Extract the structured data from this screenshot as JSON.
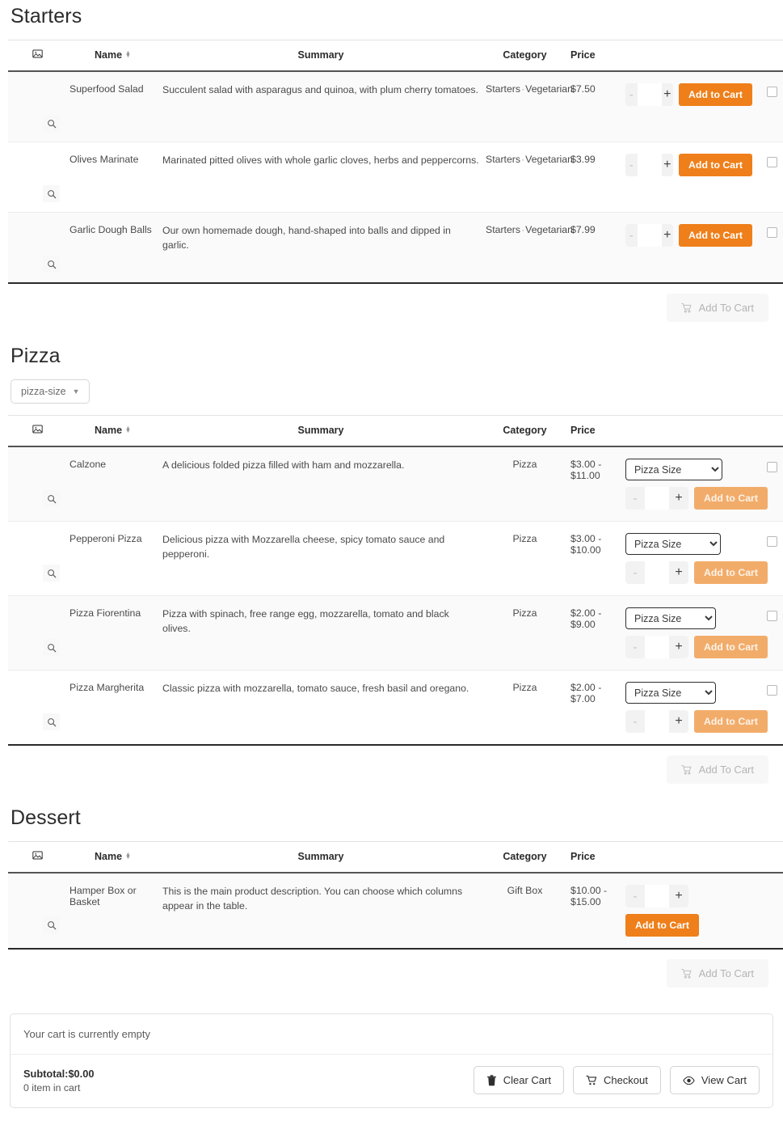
{
  "colors": {
    "accent": "#ef7f1a",
    "accent_disabled": "#f2ac6a",
    "text": "#3a3a3a"
  },
  "columns": {
    "image": "image-icon",
    "name": "Name",
    "summary": "Summary",
    "category": "Category",
    "price": "Price"
  },
  "sections": [
    {
      "id": "starters",
      "title": "Starters",
      "filter": null,
      "bulk_add_label": "Add To Cart",
      "rows": [
        {
          "name": "Superfood Salad",
          "summary": "Succulent salad with asparagus and quinoa, with plum cherry tomatoes.",
          "category": "Starters",
          "category2": "Vegetarian",
          "price": "$7.50",
          "qty": "",
          "minus_label": "-",
          "plus_label": "+",
          "add_label": "Add to Cart",
          "add_disabled": false,
          "has_select": false,
          "has_checkbox": true,
          "thumb": "salad"
        },
        {
          "name": "Olives Marinate",
          "summary": "Marinated pitted olives with whole garlic cloves, herbs and peppercorns.",
          "category": "Starters",
          "category2": "Vegetarian",
          "price": "$3.99",
          "qty": "",
          "minus_label": "-",
          "plus_label": "+",
          "add_label": "Add to Cart",
          "add_disabled": false,
          "has_select": false,
          "has_checkbox": true,
          "thumb": "olives"
        },
        {
          "name": "Garlic Dough Balls",
          "summary": "Our own homemade dough, hand-shaped into balls and dipped in garlic.",
          "category": "Starters",
          "category2": "Vegetarian",
          "price": "$7.99",
          "qty": "",
          "minus_label": "-",
          "plus_label": "+",
          "add_label": "Add to Cart",
          "add_disabled": false,
          "has_select": false,
          "has_checkbox": true,
          "thumb": "dough"
        }
      ]
    },
    {
      "id": "pizza",
      "title": "Pizza",
      "filter": {
        "label": "pizza-size",
        "icon": "chevron-down-icon"
      },
      "bulk_add_label": "Add To Cart",
      "rows": [
        {
          "name": "Calzone",
          "summary": "A delicious folded pizza filled with ham and mozzarella.",
          "category": "Pizza",
          "category2": null,
          "price": "$3.00 - $11.00",
          "qty": "",
          "minus_label": "-",
          "plus_label": "+",
          "add_label": "Add to Cart",
          "add_disabled": true,
          "has_select": true,
          "select_value": "Pizza Size",
          "select_width": 120,
          "has_checkbox": true,
          "thumb": "calzone"
        },
        {
          "name": "Pepperoni Pizza",
          "summary": "Delicious pizza with Mozzarella cheese, spicy tomato sauce and pepperoni.",
          "category": "Pizza",
          "category2": null,
          "price": "$3.00 - $10.00",
          "qty": "",
          "minus_label": "-",
          "plus_label": "+",
          "add_label": "Add to Cart",
          "add_disabled": true,
          "has_select": true,
          "select_value": "Pizza Size",
          "select_width": 118,
          "has_checkbox": true,
          "thumb": "pepperoni"
        },
        {
          "name": "Pizza Fiorentina",
          "summary": "Pizza with spinach, free range egg, mozzarella, tomato and black olives.",
          "category": "Pizza",
          "category2": null,
          "price": "$2.00 - $9.00",
          "qty": "",
          "minus_label": "-",
          "plus_label": "+",
          "add_label": "Add to Cart",
          "add_disabled": true,
          "has_select": true,
          "select_value": "Pizza Size",
          "select_width": 112,
          "has_checkbox": true,
          "thumb": "fiorentina"
        },
        {
          "name": "Pizza Margherita",
          "summary": "Classic pizza with mozzarella, tomato sauce, fresh basil and oregano.",
          "category": "Pizza",
          "category2": null,
          "price": "$2.00 - $7.00",
          "qty": "",
          "minus_label": "-",
          "plus_label": "+",
          "add_label": "Add to Cart",
          "add_disabled": true,
          "has_select": true,
          "select_value": "Pizza Size",
          "select_width": 112,
          "has_checkbox": true,
          "thumb": "margherita"
        }
      ]
    },
    {
      "id": "dessert",
      "title": "Dessert",
      "filter": null,
      "bulk_add_label": "Add To Cart",
      "rows": [
        {
          "name": "Hamper Box or Basket",
          "summary": "This is the main product description. You can choose which columns appear in the table.",
          "category": "Gift Box",
          "category2": null,
          "price": "$10.00 - $15.00",
          "qty": "",
          "minus_label": "-",
          "plus_label": "+",
          "add_label": "Add to Cart",
          "add_disabled": false,
          "has_select": false,
          "stacked": true,
          "has_checkbox": false,
          "thumb": "hamper"
        }
      ]
    }
  ],
  "cart": {
    "empty_message": "Your cart is currently empty",
    "subtotal_label": "Subtotal:$0.00",
    "item_count": "0 item in cart",
    "actions": [
      {
        "label": "Clear Cart",
        "icon": "trash-icon"
      },
      {
        "label": "Checkout",
        "icon": "cart-icon"
      },
      {
        "label": "View Cart",
        "icon": "eye-icon"
      }
    ]
  }
}
